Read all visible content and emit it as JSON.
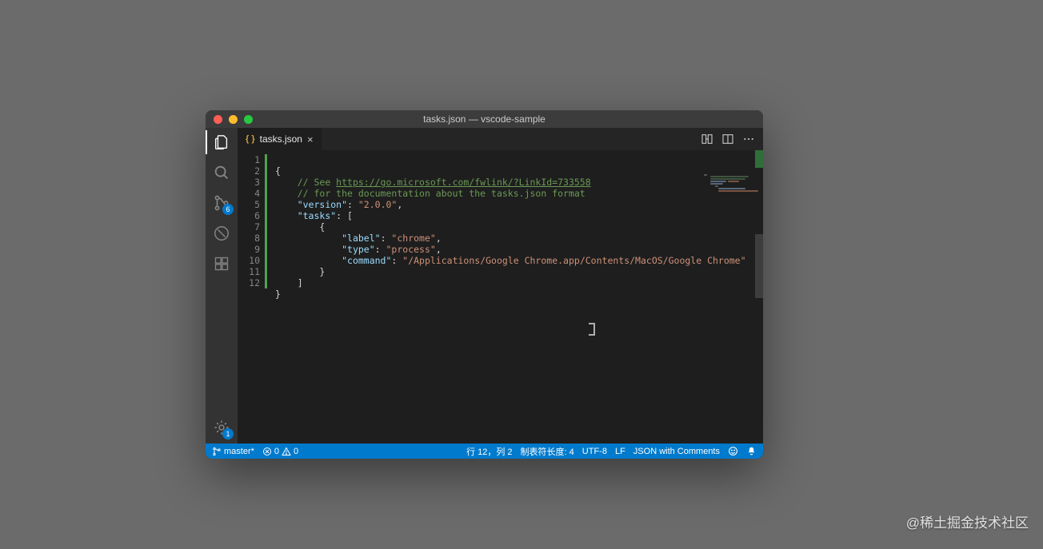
{
  "window": {
    "title": "tasks.json — vscode-sample"
  },
  "activity": {
    "scm_badge": "6",
    "settings_badge": "1"
  },
  "tab": {
    "filename": "tasks.json"
  },
  "code": {
    "lines": [
      "1",
      "2",
      "3",
      "4",
      "5",
      "6",
      "7",
      "8",
      "9",
      "10",
      "11",
      "12"
    ],
    "see_prefix": "// See ",
    "see_url": "https://go.microsoft.com/fwlink/?LinkId=733558",
    "doc_comment": "// for the documentation about the tasks.json format",
    "k_version": "\"version\"",
    "v_version": "\"2.0.0\"",
    "k_tasks": "\"tasks\"",
    "k_label": "\"label\"",
    "v_label": "\"chrome\"",
    "k_type": "\"type\"",
    "v_type": "\"process\"",
    "k_command": "\"command\"",
    "v_command": "\"/Applications/Google Chrome.app/Contents/MacOS/Google Chrome\""
  },
  "status": {
    "branch": "master*",
    "errors": "0",
    "warnings": "0",
    "position": "行 12，列 2",
    "indent": "制表符长度: 4",
    "encoding": "UTF-8",
    "eol": "LF",
    "language": "JSON with Comments"
  },
  "watermark": "@稀土掘金技术社区"
}
